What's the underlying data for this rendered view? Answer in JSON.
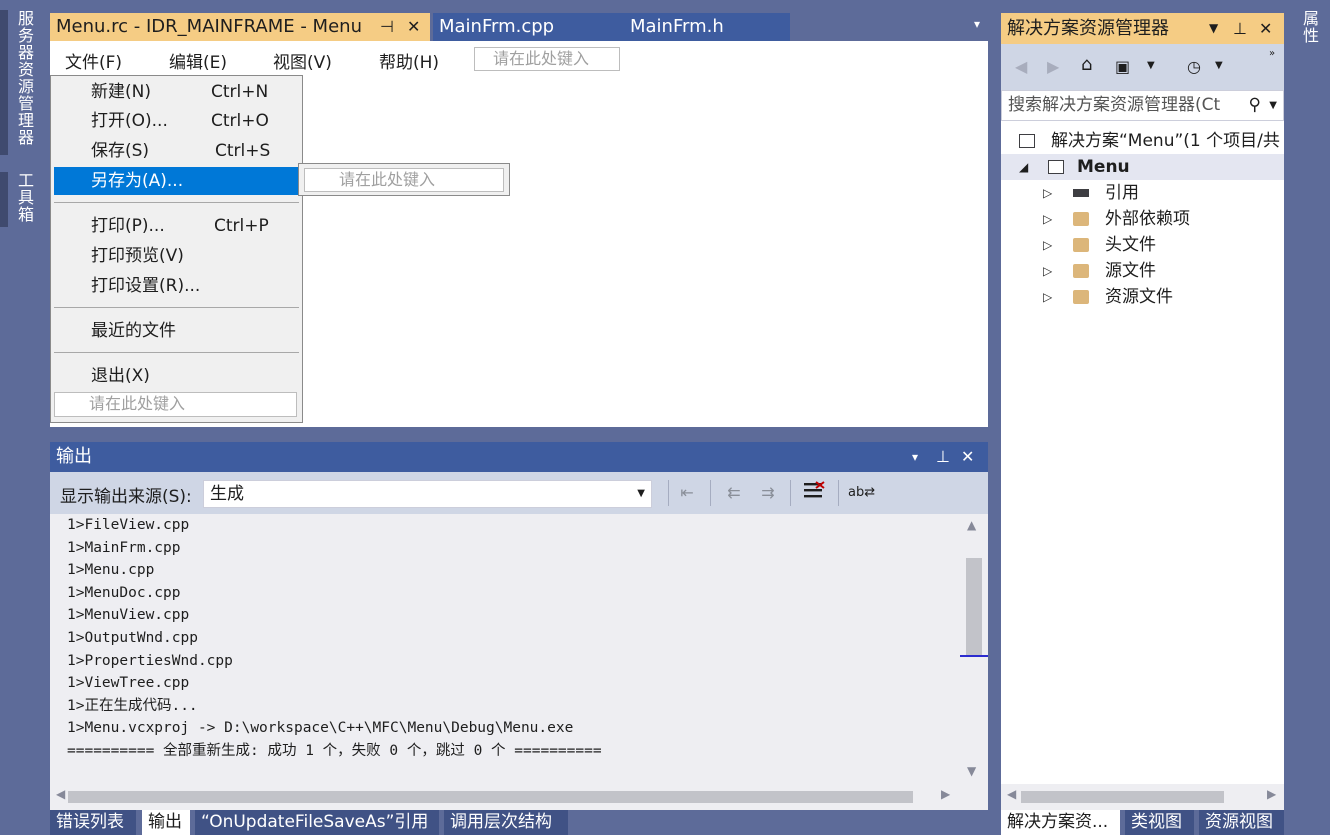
{
  "left_strip": {
    "tabs": [
      "服务器资源管理器",
      "工具箱"
    ]
  },
  "doc_tabs": [
    {
      "label": "Menu.rc - IDR_MAINFRAME - Menu",
      "active": true
    },
    {
      "label": "MainFrm.cpp",
      "active": false
    },
    {
      "label": "MainFrm.h",
      "active": false
    }
  ],
  "doc_tab_glyphs": {
    "pin": "⊣",
    "close": "✕",
    "dropdown": "▾"
  },
  "menu_editor": {
    "menubar": [
      "文件(F)",
      "编辑(E)",
      "视图(V)",
      "帮助(H)"
    ],
    "type_here": "请在此处键入",
    "file_menu": [
      {
        "label": "新建(N)",
        "shortcut": "Ctrl+N"
      },
      {
        "label": "打开(O)...",
        "shortcut": "Ctrl+O"
      },
      {
        "label": "保存(S)",
        "shortcut": "Ctrl+S"
      },
      {
        "label": "另存为(A)...",
        "shortcut": "",
        "selected": true
      },
      {
        "label": "打印(P)...",
        "shortcut": "Ctrl+P"
      },
      {
        "label": "打印预览(V)",
        "shortcut": ""
      },
      {
        "label": "打印设置(R)...",
        "shortcut": ""
      },
      {
        "label": "最近的文件",
        "shortcut": ""
      },
      {
        "label": "退出(X)",
        "shortcut": ""
      }
    ]
  },
  "output_panel": {
    "title": "输出",
    "source_label": "显示输出来源(S):",
    "source_value": "生成",
    "lines": [
      "1>FileView.cpp",
      "1>MainFrm.cpp",
      "1>Menu.cpp",
      "1>MenuDoc.cpp",
      "1>MenuView.cpp",
      "1>OutputWnd.cpp",
      "1>PropertiesWnd.cpp",
      "1>ViewTree.cpp",
      "1>正在生成代码...",
      "1>Menu.vcxproj -> D:\\workspace\\C++\\MFC\\Menu\\Debug\\Menu.exe",
      "========== 全部重新生成: 成功 1 个，失败 0 个，跳过 0 个 =========="
    ]
  },
  "bottom_tabs": [
    {
      "label": "错误列表",
      "active": false
    },
    {
      "label": "输出",
      "active": true
    },
    {
      "label": "“OnUpdateFileSaveAs”引用",
      "active": false
    },
    {
      "label": "调用层次结构",
      "active": false
    }
  ],
  "solution_explorer": {
    "title": "解决方案资源管理器",
    "search_placeholder": "搜索解决方案资源管理器(Ct",
    "solution_label": "解决方案“Menu”(1 个项目/共",
    "project_label": "Menu",
    "children": [
      "引用",
      "外部依赖项",
      "头文件",
      "源文件",
      "资源文件"
    ],
    "bottom_tabs": [
      "解决方案资...",
      "类视图",
      "资源视图"
    ]
  },
  "properties_tab": "属性",
  "colors": {
    "frame": "#5d6b99",
    "active_tab": "#f5cc84",
    "inactive_tab": "#3e5c9f",
    "selection": "#0078d7"
  }
}
